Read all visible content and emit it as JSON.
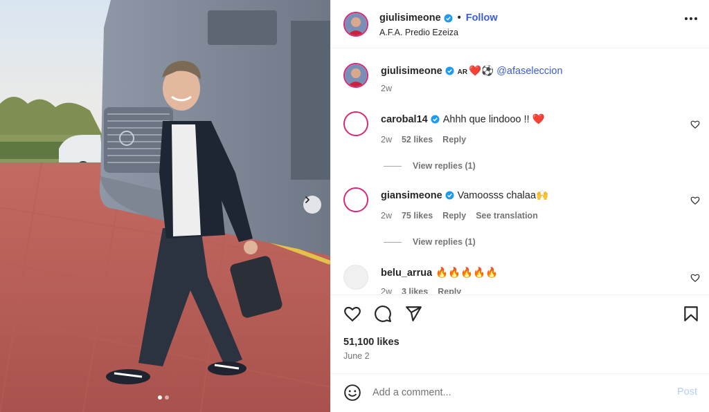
{
  "post": {
    "author": "giulisimeone",
    "follow_label": "Follow",
    "separator": "•",
    "location": "A.F.A. Predio Ezeiza",
    "more_icon": "more-options-icon",
    "carousel": {
      "total": 2,
      "current": 1,
      "next_icon": "chevron-right-icon"
    }
  },
  "caption": {
    "username": "giulisimeone",
    "flag": "AR",
    "emojis": "❤️⚽",
    "mention": "@afaseleccion",
    "time": "2w"
  },
  "comments": [
    {
      "username": "carobal14",
      "verified": true,
      "text": "Ahhh que lindooo !! ❤️",
      "time": "2w",
      "likes": "52 likes",
      "reply": "Reply",
      "view_replies": "View replies (1)"
    },
    {
      "username": "giansimeone",
      "verified": true,
      "text": "Vamoosss chalaa🙌",
      "time": "2w",
      "likes": "75 likes",
      "reply": "Reply",
      "translation": "See translation",
      "view_replies": "View replies (1)"
    },
    {
      "username": "belu_arrua",
      "verified": false,
      "text": "🔥🔥🔥🔥🔥",
      "time": "2w",
      "likes": "3 likes",
      "reply": "Reply"
    }
  ],
  "actions": {
    "like_icon": "heart-icon",
    "comment_icon": "comment-icon",
    "share_icon": "share-icon",
    "save_icon": "bookmark-icon"
  },
  "stats": {
    "likes": "51,100 likes",
    "date": "June 2"
  },
  "composer": {
    "placeholder": "Add a comment...",
    "post_label": "Post",
    "emoji_icon": "emoji-icon"
  },
  "colors": {
    "link": "#3a5bd9",
    "muted": "#737373",
    "text": "#262626",
    "verified": "#1d9bf0",
    "like_red": "#e0245e"
  }
}
